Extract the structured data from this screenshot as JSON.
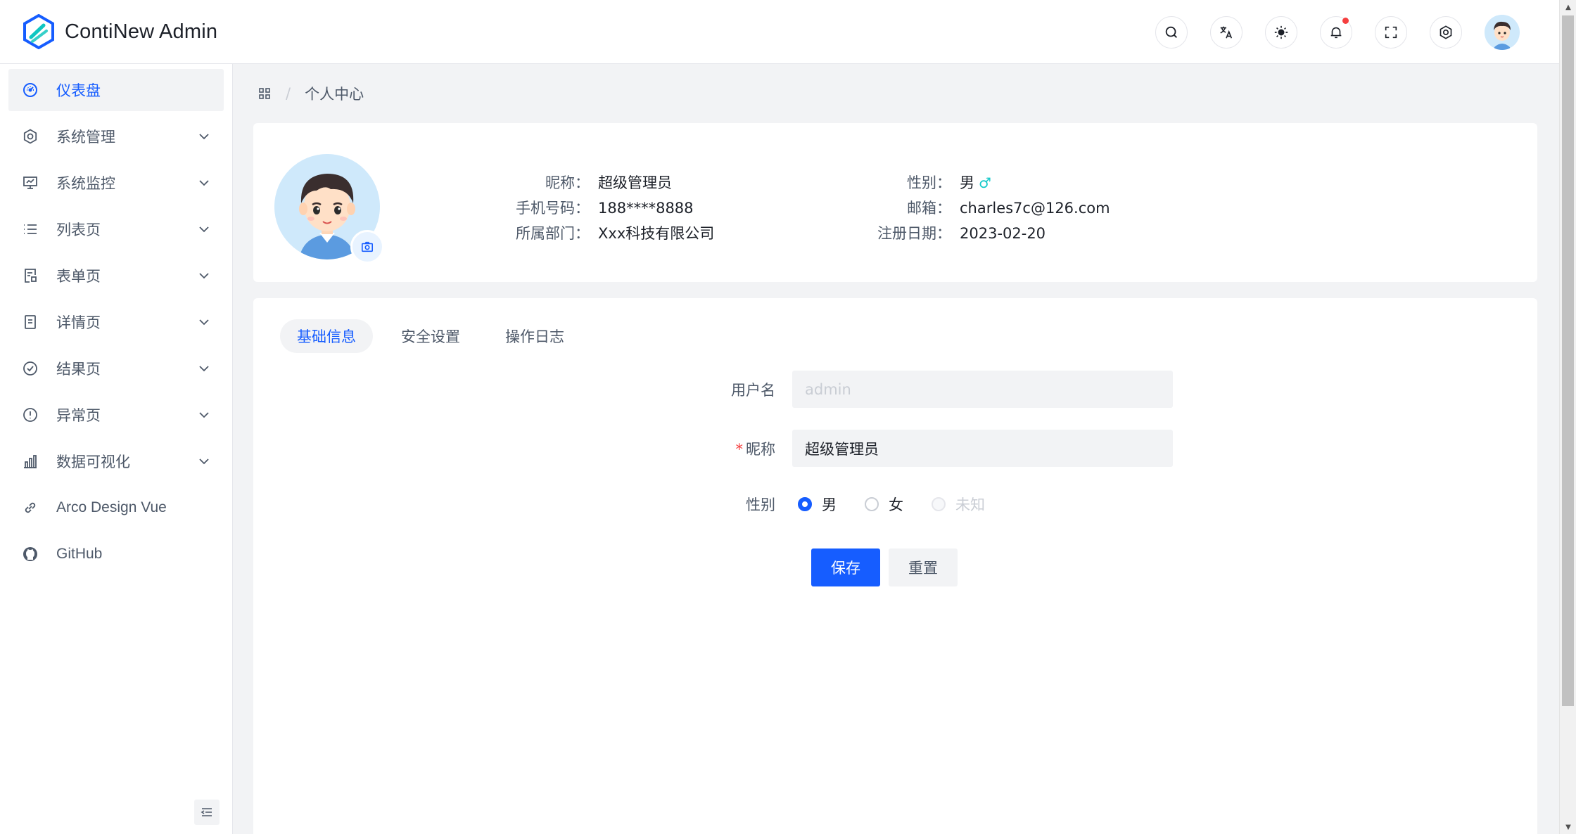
{
  "app": {
    "title": "ContiNew Admin"
  },
  "header": {
    "actions": [
      "search-icon",
      "translate-icon",
      "theme-icon",
      "notification-icon",
      "fullscreen-icon",
      "settings-icon"
    ]
  },
  "sidebar": {
    "items": [
      {
        "label": "仪表盘",
        "icon": "dashboard-icon",
        "active": true,
        "expandable": false
      },
      {
        "label": "系统管理",
        "icon": "gear-icon",
        "expandable": true
      },
      {
        "label": "系统监控",
        "icon": "monitor-icon",
        "expandable": true
      },
      {
        "label": "列表页",
        "icon": "list-icon",
        "expandable": true
      },
      {
        "label": "表单页",
        "icon": "form-icon",
        "expandable": true
      },
      {
        "label": "详情页",
        "icon": "file-icon",
        "expandable": true
      },
      {
        "label": "结果页",
        "icon": "check-circle-icon",
        "expandable": true
      },
      {
        "label": "异常页",
        "icon": "exclamation-circle-icon",
        "expandable": true
      },
      {
        "label": "数据可视化",
        "icon": "bar-chart-icon",
        "expandable": true
      },
      {
        "label": "Arco Design Vue",
        "icon": "link-icon",
        "expandable": false
      },
      {
        "label": "GitHub",
        "icon": "github-icon",
        "expandable": false
      }
    ]
  },
  "breadcrumb": {
    "current": "个人中心",
    "separator": "/"
  },
  "profile": {
    "nickname_label": "昵称：",
    "nickname": "超级管理员",
    "phone_label": "手机号码：",
    "phone": "188****8888",
    "dept_label": "所属部门：",
    "dept": "Xxx科技有限公司",
    "gender_label": "性别：",
    "gender": "男",
    "gender_symbol": "♂",
    "email_label": "邮箱：",
    "email": "charles7c@126.com",
    "reg_label": "注册日期：",
    "reg_date": "2023-02-20"
  },
  "tabs": [
    {
      "label": "基础信息",
      "active": true
    },
    {
      "label": "安全设置"
    },
    {
      "label": "操作日志"
    }
  ],
  "form": {
    "username_label": "用户名",
    "username_value": "admin",
    "nickname_label": "昵称",
    "nickname_value": "超级管理员",
    "required_mark": "*",
    "gender_label": "性别",
    "gender_options": [
      "男",
      "女",
      "未知"
    ],
    "gender_selected": "男",
    "save_label": "保存",
    "reset_label": "重置"
  },
  "colors": {
    "primary": "#165dff",
    "accent": "#14c9c9",
    "danger": "#f53f3f"
  }
}
